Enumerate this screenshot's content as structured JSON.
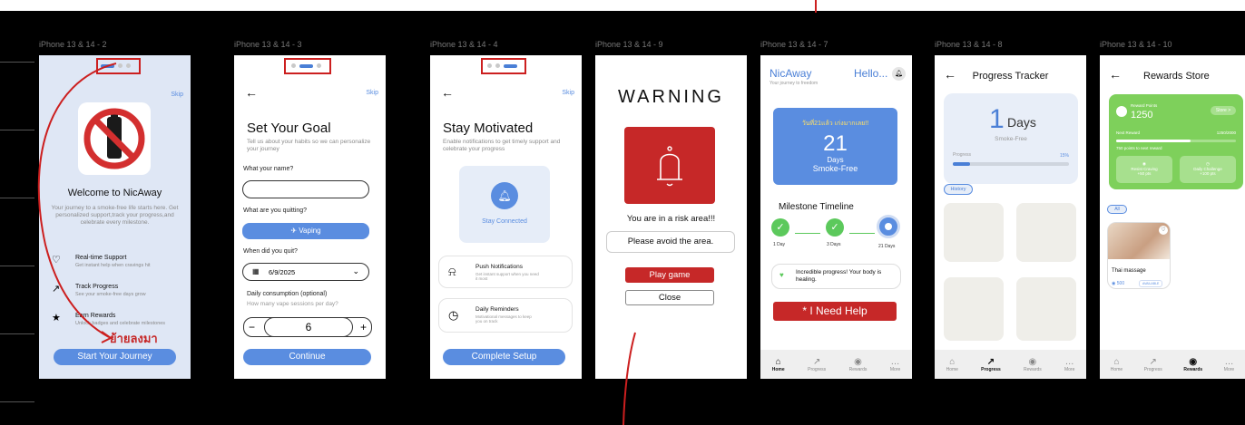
{
  "frames": [
    {
      "label": "iPhone 13 & 14 - 2"
    },
    {
      "label": "iPhone 13 & 14 - 3"
    },
    {
      "label": "iPhone 13 & 14 - 4"
    },
    {
      "label": "iPhone 13 & 14 - 9"
    },
    {
      "label": "iPhone 13 & 14 - 7"
    },
    {
      "label": "iPhone 13 & 14 - 8"
    },
    {
      "label": "iPhone 13 & 14 - 10"
    }
  ],
  "welcome": {
    "skip": "Skip",
    "title": "Welcome to NicAway",
    "body": "Your journey to a smoke-free life starts here. Get personalized support,track your progress,and celebrate every milestone.",
    "features": [
      {
        "title": "Real-time Support",
        "desc": "Get instant help when cravings hit"
      },
      {
        "title": "Track Progress",
        "desc": "See your smoke-free days grow"
      },
      {
        "title": "Earn Rewards",
        "desc": "Unlock badges and celebrate milestones"
      }
    ],
    "annotation": "ย้ายลงมา",
    "cta": "Start Your Journey"
  },
  "goal": {
    "skip": "Skip",
    "title": "Set Your Goal",
    "subtitle": "Tell us about your habits so we can personalize your journey",
    "name_label": "What are your name?",
    "name_label_real": "What your name?",
    "quit_label": "What are you quitting?",
    "quit_value": "Vaping",
    "date_label": "When did you quit?",
    "date_value": "6/9/2025",
    "consumption_label": "Daily consumption (optional)",
    "consumption_hint": "How many vape sessions per day?",
    "count": "6",
    "minus": "−",
    "plus": "+",
    "cta": "Continue"
  },
  "motivated": {
    "skip": "Skip",
    "title": "Stay Motivated",
    "subtitle": "Enable notifications to get timely support and celebrate your progress",
    "connected": "Stay Connected",
    "options": [
      {
        "title": "Push Notifications",
        "desc": "Get instant support when you need it most"
      },
      {
        "title": "Daily Reminders",
        "desc": "Motivational messages to keep you on track"
      }
    ],
    "cta": "Complete Setup"
  },
  "warning": {
    "title": "WARNING",
    "risk": "You are in a risk area!!!",
    "avoid": "Please avoid the area.",
    "play": "Play game",
    "close": "Close"
  },
  "home": {
    "brand": "NicAway",
    "tagline": "Your journey to freedom",
    "hello": "Hello...",
    "thai": "วันที่21แล้ว เก่งมากเลย!!",
    "days": "21",
    "days_label": "Days",
    "smoke_free": "Smoke-Free",
    "milestone_title": "Milestone Timeline",
    "milestones": [
      "1 Day",
      "3 Days",
      "21 Days"
    ],
    "msg": "Incredible progress! Your body is healing.",
    "help": "* I Need Help"
  },
  "tracker": {
    "title": "Progress Tracker",
    "days": "1",
    "days_label": "Days",
    "smoke_free": "Smoke-Free",
    "progress_label": "Progress",
    "progress_pct": "15%",
    "progress_value": 0.15,
    "history": "History"
  },
  "rewards": {
    "title": "Rewards Store",
    "points_label": "Reward Points",
    "points": "1250",
    "store": "Store >",
    "next_label": "Next Reward",
    "next_value": "1250/2000",
    "next_progress": 0.62,
    "to_next": "750 points to next reward",
    "resist": "Resist Craving",
    "resist_pts": "+50 pts",
    "challenge": "Daily Challenge",
    "challenge_pts": "+100 pts",
    "filter": "All",
    "item": "Thai massage",
    "item_pts": "500",
    "item_status": "AVAILABLE"
  },
  "nav": {
    "home": "Home",
    "progress": "Progress",
    "rewards": "Rewards",
    "more": "More"
  }
}
